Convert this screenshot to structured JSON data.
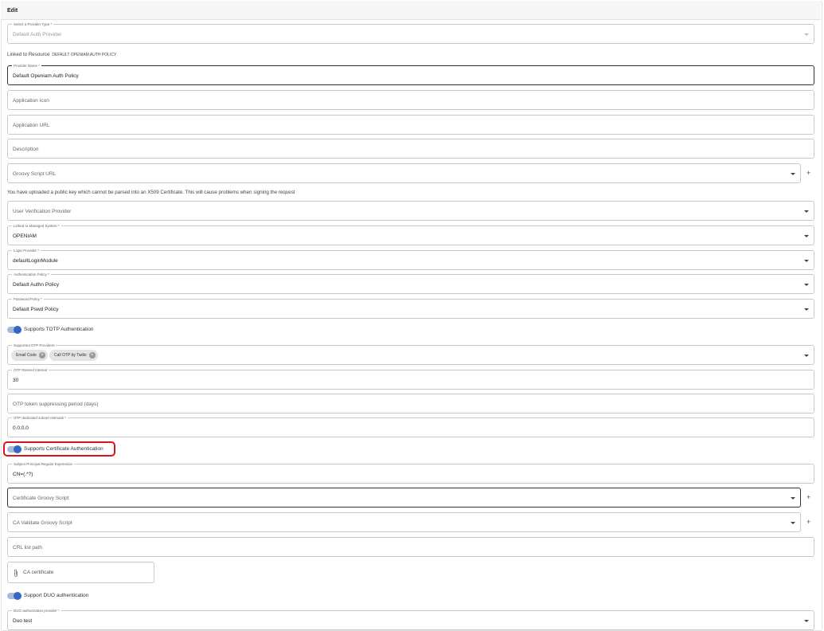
{
  "header": {
    "title": "Edit"
  },
  "provider_type": {
    "label": "Select a Provider Type *",
    "value": "Default Auth Provider"
  },
  "linked_resource": {
    "label": "Linked to Resource",
    "value": "DEFAULT OPENIAM AUTH POLICY"
  },
  "provider_name": {
    "label": "Provider Name *",
    "value": "Default Openiam Auth Policy"
  },
  "application_icon": {
    "placeholder": "Application Icon"
  },
  "application_url": {
    "placeholder": "Application URL"
  },
  "description": {
    "placeholder": "Description"
  },
  "groovy_script_url": {
    "placeholder": "Groovy Script URL",
    "add_label": "+"
  },
  "warning": "You have uploaded a public key which cannot be parsed into an X509 Certificate. This will cause problems when signing the request",
  "user_verification_provider": {
    "placeholder": "User Verification Provider"
  },
  "managed_system": {
    "label": "Linked to Managed System *",
    "value": "OPENIAM"
  },
  "login_provider": {
    "label": "Login Provider *",
    "value": "defaultLoginModule"
  },
  "authentication_policy": {
    "label": "Authentication Policy *",
    "value": "Default Authn Policy"
  },
  "password_policy": {
    "label": "Password Policy *",
    "value": "Default Pswd Policy"
  },
  "totp": {
    "label": "Supports TOTP Authentication",
    "on": true
  },
  "otp_providers": {
    "label": "Supported OTP Providers",
    "chips": [
      "Email Code",
      "Call OTP by Twilio"
    ],
    "remove_glyph": "×"
  },
  "otp_resend": {
    "label": "OTP Resend Interval",
    "value": "30"
  },
  "otp_suppress": {
    "placeholder": "OTP token suppressing period (days)"
  },
  "otp_subnet": {
    "label": "OTP dedicated subnet netmask *",
    "value": "0.0.0.0"
  },
  "cert_auth": {
    "label": "Supports Certificate Authentication",
    "on": true
  },
  "subject_regex": {
    "label": "Subject Principal Regular Expression",
    "value": "CN=(.*?)"
  },
  "cert_groovy": {
    "placeholder": "Certificate Groovy Script",
    "add_label": "+"
  },
  "ca_validate_groovy": {
    "placeholder": "CA Validate Groovy Script",
    "add_label": "+"
  },
  "crl_path": {
    "placeholder": "CRL list path"
  },
  "ca_certificate": {
    "placeholder": "CA certificate"
  },
  "duo": {
    "label": "Support DUO authentication",
    "on": true
  },
  "duo_provider": {
    "label": "DUO authorization provider *",
    "value": "Duo test"
  },
  "colors": {
    "toggle_knob": "#3467c4",
    "toggle_track": "#a9b9d9",
    "highlight": "#d9141b"
  }
}
